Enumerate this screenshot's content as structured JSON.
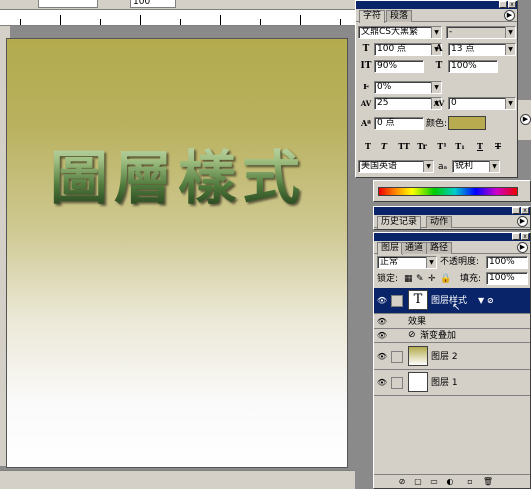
{
  "options_bar": {
    "field1": "",
    "field2": "100"
  },
  "canvas": {
    "text": "圖層樣式",
    "gradient_top": "#b3ab4e",
    "gradient_bottom": "#ffffff",
    "text_top_color": "#d9e8c8",
    "text_bottom_color": "#1a3315"
  },
  "character_panel": {
    "tabs": [
      "字符",
      "段落"
    ],
    "font_family": "文鼎CS大黑繁",
    "font_style": "-",
    "font_size": "100 点",
    "leading": "13 点",
    "vertical_scale": "90%",
    "horizontal_scale": "100%",
    "baseline_shift_pct": "0%",
    "tracking": "25",
    "kerning": "0",
    "baseline_shift": "0 点",
    "color_label": "颜色:",
    "color_value": "#b8ab4f",
    "style_buttons": [
      "T",
      "T",
      "TT",
      "Tr",
      "T¹",
      "T₁",
      "T",
      "T"
    ],
    "language": "美国英语",
    "aa_label": "aₐ",
    "antialias": "锐利"
  },
  "history_panel": {
    "tabs": [
      "历史记录",
      "动作"
    ]
  },
  "layers_panel": {
    "tabs": [
      "图层",
      "通道",
      "路径"
    ],
    "blend_mode": "正常",
    "opacity_label": "不透明度:",
    "opacity": "100%",
    "lock_label": "锁定:",
    "fill_label": "填充:",
    "fill": "100%",
    "layers": [
      {
        "name": "图层样式",
        "type": "text",
        "selected": true
      },
      {
        "name": "效果",
        "type": "effects-header"
      },
      {
        "name": "渐变叠加",
        "type": "effect"
      },
      {
        "name": "图层 2",
        "type": "gradient"
      },
      {
        "name": "图层 1",
        "type": "white"
      }
    ]
  }
}
